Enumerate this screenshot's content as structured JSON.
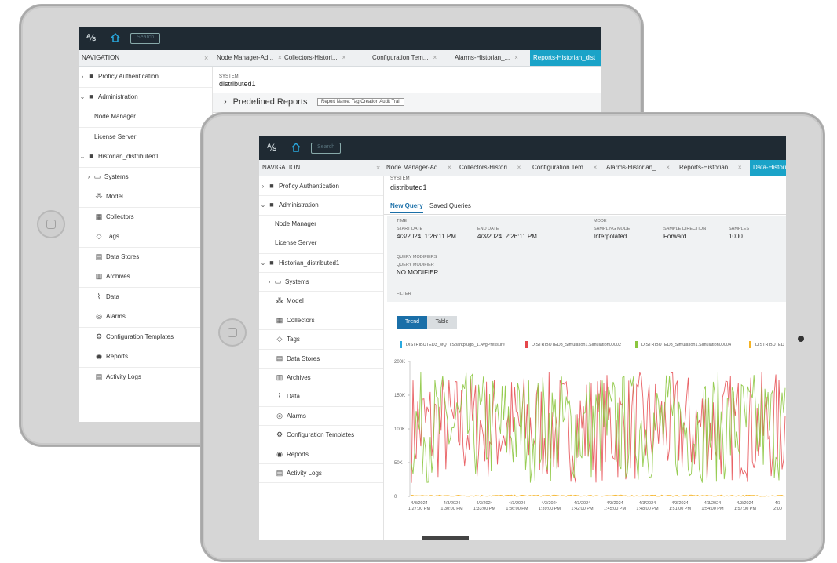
{
  "app": {
    "navigation_label": "NAVIGATION",
    "logo_glyph": "⅍",
    "search_placeholder": "Search"
  },
  "back": {
    "tabs": [
      "Node Manager-Ad...",
      "Collectors-Histori...",
      "Configuration Tem...",
      "Alarms-Historian_...",
      "Reports-Historian_dist"
    ],
    "system_label": "SYSTEM",
    "system_value": "distributed1",
    "predefined_reports": "Predefined Reports",
    "report_name_chip": "Report Name: Tag Creation Audit Trail",
    "sidebar": [
      {
        "label": "Proficy Authentication",
        "chev": "›",
        "icon": "folder"
      },
      {
        "label": "Administration",
        "chev": "⌄",
        "icon": "folder"
      },
      {
        "label": "Node Manager"
      },
      {
        "label": "License Server"
      },
      {
        "label": "Historian_distributed1",
        "chev": "⌄",
        "icon": "folder"
      },
      {
        "label": "Systems",
        "chev": "›",
        "icon": "systems"
      },
      {
        "label": "Model",
        "icon": "model"
      },
      {
        "label": "Collectors",
        "icon": "collectors"
      },
      {
        "label": "Tags",
        "icon": "tags"
      },
      {
        "label": "Data Stores",
        "icon": "datastores"
      },
      {
        "label": "Archives",
        "icon": "archives"
      },
      {
        "label": "Data",
        "icon": "data"
      },
      {
        "label": "Alarms",
        "icon": "alarms"
      },
      {
        "label": "Configuration Templates",
        "icon": "config"
      },
      {
        "label": "Reports",
        "icon": "reports"
      },
      {
        "label": "Activity Logs",
        "icon": "logs"
      }
    ]
  },
  "front": {
    "tabs": [
      "Node Manager-Ad...",
      "Collectors-Histori...",
      "Configuration Tem...",
      "Alarms-Historian_...",
      "Reports-Historian...",
      "Data-Histori"
    ],
    "system_label": "SYSTEM",
    "system_value": "distributed1",
    "subtabs": [
      "New Query",
      "Saved Queries"
    ],
    "time_label": "TIME",
    "start_date_label": "START DATE",
    "start_date": "4/3/2024, 1:26:11 PM",
    "end_date_label": "END DATE",
    "end_date": "4/3/2024, 2:26:11 PM",
    "mode_label": "MODE",
    "sampling_mode_label": "SAMPLING MODE",
    "sampling_mode": "Interpolated",
    "sample_direction_label": "SAMPLE DIRECTION",
    "sample_direction": "Forward",
    "samples_label": "SAMPLES",
    "samples": "1000",
    "query_modifiers_label": "QUERY MODIFIERS",
    "query_modifier_label": "QUERY MODIFIER",
    "query_modifier": "NO MODIFIER",
    "filter_label": "FILTER",
    "view_toggle": [
      "Trend",
      "Table"
    ],
    "legend": [
      {
        "name": "DISTRIBUTED3_MQTTSparkplugB_1.AvgPressure",
        "color": "#29a9e0"
      },
      {
        "name": "DISTRIBUTED3_Simulation1.Simulation00002",
        "color": "#e5474b"
      },
      {
        "name": "DISTRIBUTED3_Simulation1.Simulation00004",
        "color": "#8cc63f"
      },
      {
        "name": "DISTRIBUTED",
        "color": "#f5b324"
      }
    ]
  },
  "chart_data": {
    "type": "line",
    "ylim": [
      0,
      200000
    ],
    "y_ticks": [
      "0",
      "50K",
      "100K",
      "150K",
      "200K"
    ],
    "x_tick_labels": [
      [
        "4/3/2024",
        "1:27:00 PM"
      ],
      [
        "4/3/2024",
        "1:30:00 PM"
      ],
      [
        "4/3/2024",
        "1:33:00 PM"
      ],
      [
        "4/3/2024",
        "1:36:00 PM"
      ],
      [
        "4/3/2024",
        "1:39:00 PM"
      ],
      [
        "4/3/2024",
        "1:42:00 PM"
      ],
      [
        "4/3/2024",
        "1:45:00 PM"
      ],
      [
        "4/3/2024",
        "1:48:00 PM"
      ],
      [
        "4/3/2024",
        "1:51:00 PM"
      ],
      [
        "4/3/2024",
        "1:54:00 PM"
      ],
      [
        "4/3/2024",
        "1:57:00 PM"
      ],
      [
        "4/3",
        "2:00"
      ]
    ],
    "series": [
      {
        "name": "DISTRIBUTED3_Simulation1.Simulation00002",
        "color": "#e5474b",
        "range": [
          20000,
          185000
        ]
      },
      {
        "name": "DISTRIBUTED3_Simulation1.Simulation00004",
        "color": "#8cc63f",
        "range": [
          20000,
          185000
        ]
      },
      {
        "name": "DISTRIBUTED3_MQTTSparkplugB_1.AvgPressure",
        "color": "#f5b324",
        "range": [
          0,
          2000
        ]
      }
    ]
  }
}
